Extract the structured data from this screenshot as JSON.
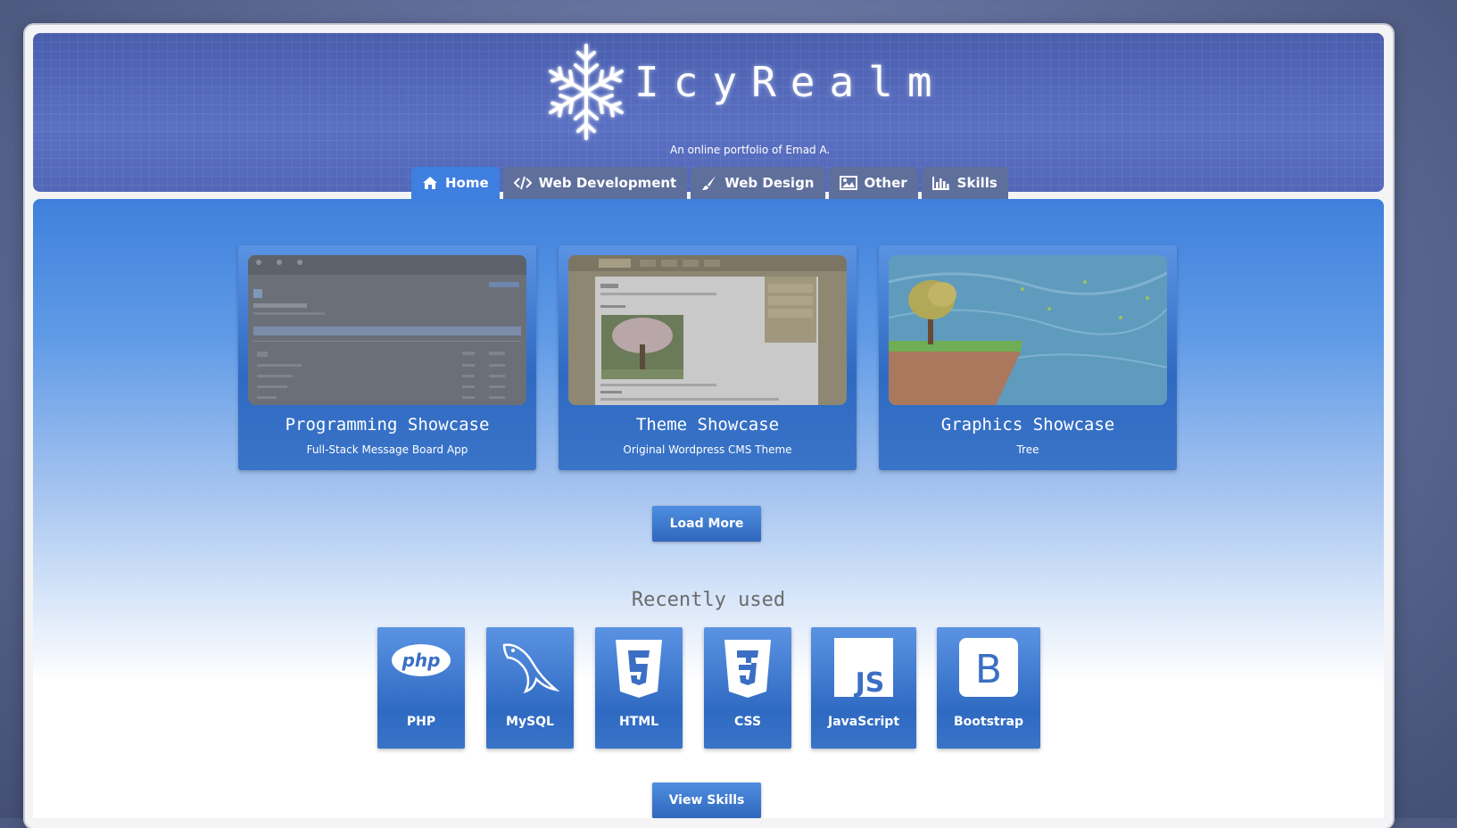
{
  "site": {
    "title": "IcyRealm",
    "subtitle": "An online portfolio of Emad A."
  },
  "nav": {
    "tabs": [
      {
        "label": "Home",
        "icon": "home-icon",
        "active": true
      },
      {
        "label": "Web Development",
        "icon": "code-icon",
        "active": false
      },
      {
        "label": "Web Design",
        "icon": "brush-icon",
        "active": false
      },
      {
        "label": "Other",
        "icon": "image-icon",
        "active": false
      },
      {
        "label": "Skills",
        "icon": "bar-chart-icon",
        "active": false
      }
    ]
  },
  "showcase": {
    "cards": [
      {
        "title": "Programming Showcase",
        "subtitle": "Full-Stack Message Board App"
      },
      {
        "title": "Theme Showcase",
        "subtitle": "Original Wordpress CMS Theme"
      },
      {
        "title": "Graphics Showcase",
        "subtitle": "Tree"
      }
    ],
    "load_more_label": "Load More"
  },
  "recent": {
    "title": "Recently used",
    "skills": [
      {
        "label": "PHP",
        "icon": "php-icon"
      },
      {
        "label": "MySQL",
        "icon": "mysql-icon"
      },
      {
        "label": "HTML",
        "icon": "html5-icon"
      },
      {
        "label": "CSS",
        "icon": "css3-icon"
      },
      {
        "label": "JavaScript",
        "icon": "js-icon"
      },
      {
        "label": "Bootstrap",
        "icon": "bootstrap-icon"
      }
    ],
    "view_skills_label": "View Skills"
  },
  "colors": {
    "accent": "#3e7fe0",
    "header": "#4f64b4",
    "tab_inactive": "#5f6f9c"
  }
}
